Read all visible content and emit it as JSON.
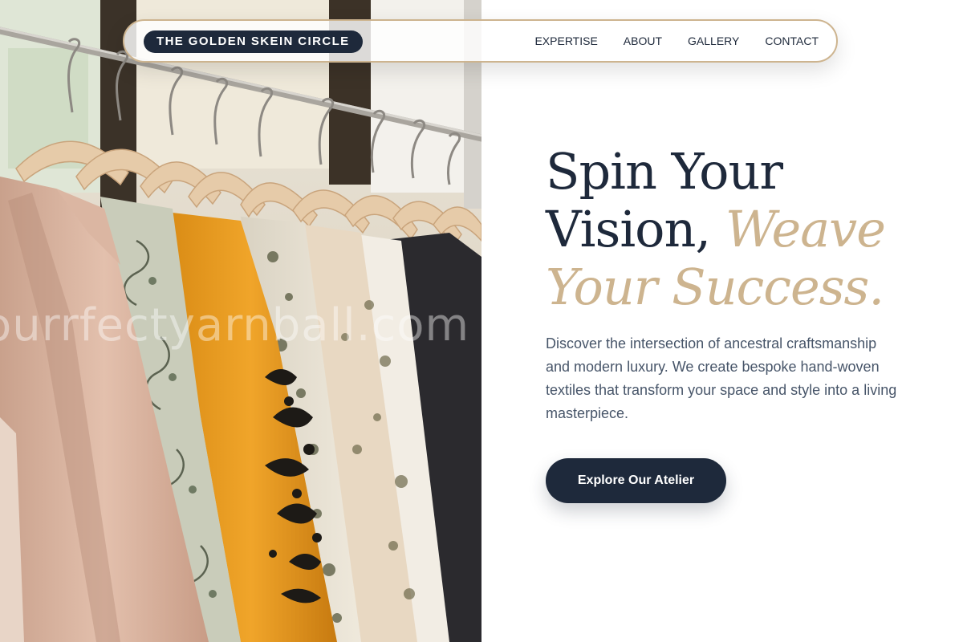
{
  "nav": {
    "brand": "THE GOLDEN SKEIN CIRCLE",
    "links": [
      "EXPERTISE",
      "ABOUT",
      "GALLERY",
      "CONTACT"
    ]
  },
  "hero": {
    "headline_line1": "Spin Your",
    "headline_line2": "Vision, ",
    "headline_accent_1": "Weave",
    "headline_accent_2": "Your Success.",
    "description": "Discover the intersection of ancestral craftsmanship and modern luxury. We create bespoke hand-woven textiles that transform your space and style into a living masterpiece.",
    "cta_label": "Explore Our Atelier",
    "image_watermark": "ourrfectyarnball.com"
  },
  "colors": {
    "navy": "#1e293b",
    "gold": "#cdb48f",
    "body_text": "#475569"
  }
}
